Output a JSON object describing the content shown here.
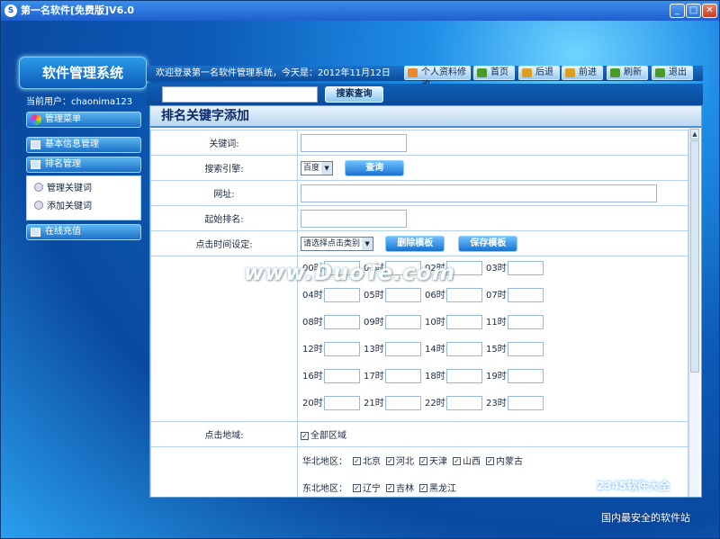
{
  "window": {
    "title": "第一名软件[免费版]V6.0",
    "logo_char": "S"
  },
  "sidebar": {
    "system_name": "软件管理系统",
    "current_user": "当前用户：chaonima123",
    "menu_header": "管理菜单",
    "items": [
      {
        "label": "基本信息管理"
      },
      {
        "label": "排名管理"
      },
      {
        "label": "在线充值"
      }
    ],
    "sub_items": [
      {
        "label": "管理关键词"
      },
      {
        "label": "添加关键词"
      }
    ]
  },
  "topbar": {
    "welcome": "欢迎登录第一名软件管理系统，今天是：2012年11月12日",
    "buttons": [
      {
        "label": "个人资料修改"
      },
      {
        "label": "首页"
      },
      {
        "label": "后退"
      },
      {
        "label": "前进"
      },
      {
        "label": "刷新"
      },
      {
        "label": "退出"
      }
    ]
  },
  "search": {
    "value": "",
    "button": "搜索查询"
  },
  "form": {
    "title": "排名关键字添加",
    "keyword_label": "关键词:",
    "engine_label": "搜索引擎:",
    "engine_value": "百度",
    "query_button": "查询",
    "url_label": "网址:",
    "start_rank_label": "起始排名:",
    "time_label": "点击时间设定:",
    "time_select": "请选择点击类别",
    "delete_template": "删除模板",
    "save_template": "保存模板",
    "hours": [
      "00时",
      "01时",
      "02时",
      "03时",
      "04时",
      "05时",
      "06时",
      "07时",
      "08时",
      "09时",
      "10时",
      "11时",
      "12时",
      "13时",
      "14时",
      "15时",
      "16时",
      "17时",
      "18时",
      "19时",
      "20时",
      "21时",
      "22时",
      "23时"
    ],
    "region_label": "点击地域:",
    "all_regions": "全部区域",
    "regions": [
      {
        "name": "华北地区：",
        "items": [
          "北京",
          "河北",
          "天津",
          "山西",
          "内蒙古"
        ]
      },
      {
        "name": "东北地区：",
        "items": [
          "辽宁",
          "吉林",
          "黑龙江"
        ]
      }
    ]
  },
  "overlay": {
    "watermark": "www.DuoTe.com",
    "brand": "2345软件大全",
    "brand_tag": "国内最安全的软件站"
  }
}
